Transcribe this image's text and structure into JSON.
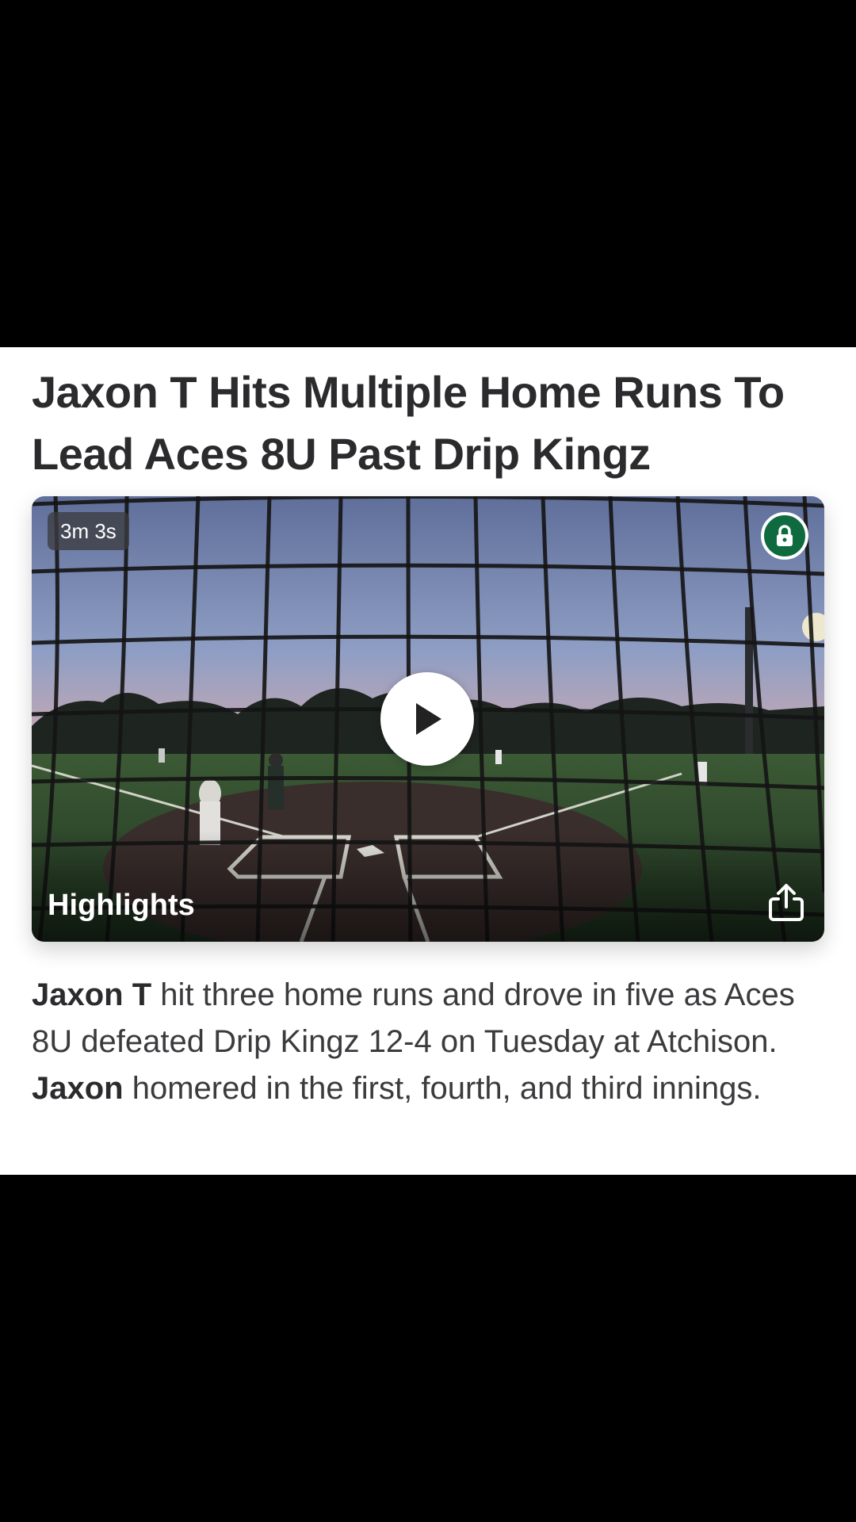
{
  "article": {
    "headline": "Jaxon T Hits Multiple Home Runs To Lead Aces 8U Past Drip Kingz",
    "summary": {
      "player_name": "Jaxon T",
      "part1": " hit three home runs and drove in five as Aces 8U defeated Drip Kingz 12-4 on Tuesday at Atchison. ",
      "player_first": "Jaxon",
      "part2": " homered in the first, fourth, and third innings."
    }
  },
  "video": {
    "duration": "3m 3s",
    "label": "Highlights",
    "lock_badge_color": "#0f6b3f",
    "icons": {
      "lock": "lock-icon",
      "play": "play-icon",
      "share": "share-icon"
    }
  }
}
